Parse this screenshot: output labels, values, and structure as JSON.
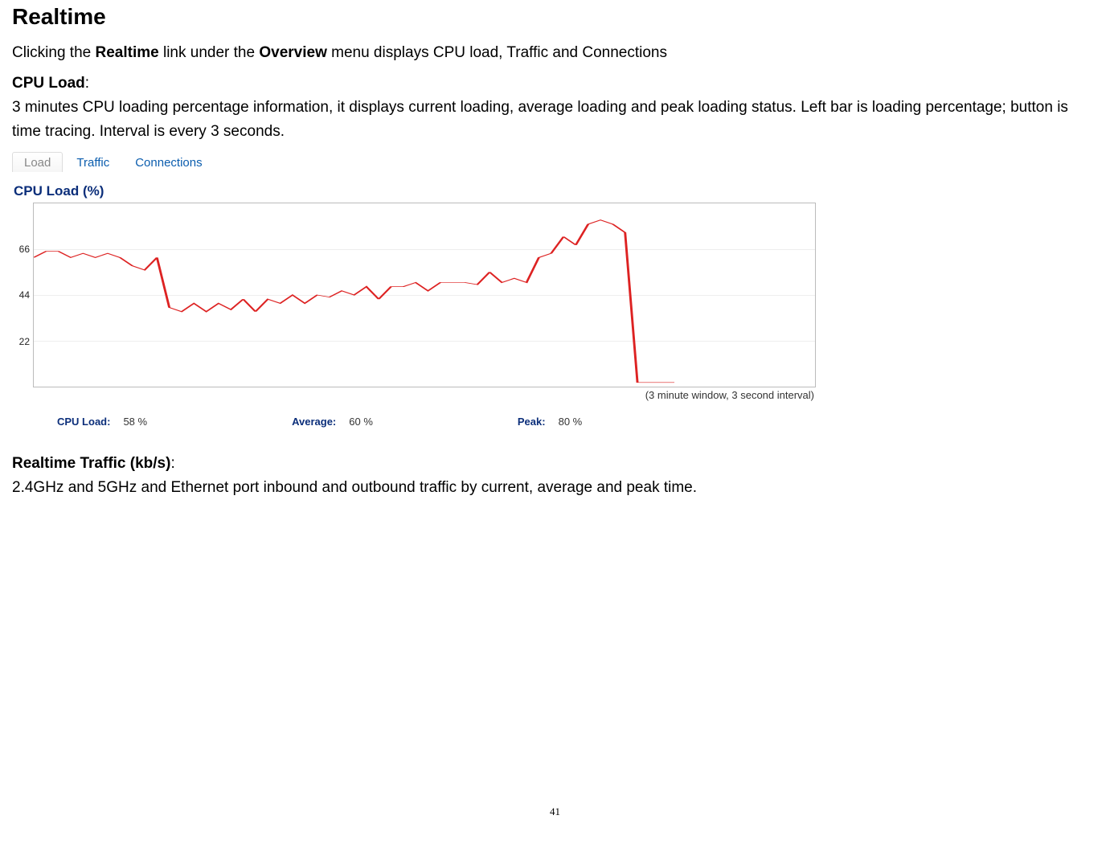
{
  "title": "Realtime",
  "intro_pre": "Clicking the ",
  "intro_b1": "Realtime",
  "intro_mid": " link under the ",
  "intro_b2": "Overview",
  "intro_post": " menu displays CPU load, Traffic and Connections",
  "cpu": {
    "heading_b": "CPU Load",
    "heading_colon": ":",
    "desc": "3 minutes CPU loading percentage information, it displays current loading, average loading and peak loading status. Left bar is loading percentage; button is time tracing. Interval is every 3 seconds."
  },
  "tabs": {
    "load": "Load",
    "traffic": "Traffic",
    "connections": "Connections"
  },
  "chart_data": {
    "type": "line",
    "title": "CPU Load (%)",
    "yticks": [
      66,
      44,
      22
    ],
    "ylim": [
      0,
      88
    ],
    "window_note": "(3 minute window, 3 second interval)",
    "values": [
      62,
      65,
      65,
      62,
      64,
      62,
      64,
      62,
      58,
      56,
      62,
      38,
      36,
      40,
      36,
      40,
      37,
      42,
      36,
      42,
      40,
      44,
      40,
      44,
      43,
      46,
      44,
      48,
      42,
      48,
      48,
      50,
      46,
      50,
      50,
      50,
      49,
      55,
      50,
      52,
      50,
      62,
      64,
      72,
      68,
      78,
      80,
      78,
      74,
      2,
      2,
      2,
      2
    ],
    "stats": {
      "cpu_label": "CPU Load:",
      "cpu_value": "58 %",
      "avg_label": "Average:",
      "avg_value": "60 %",
      "peak_label": "Peak:",
      "peak_value": "80 %"
    }
  },
  "traffic": {
    "heading_b": "Realtime Traffic (kb/s)",
    "heading_colon": ":",
    "desc": "2.4GHz and 5GHz and Ethernet port inbound and outbound traffic by current, average and peak time."
  },
  "page_number": "41"
}
